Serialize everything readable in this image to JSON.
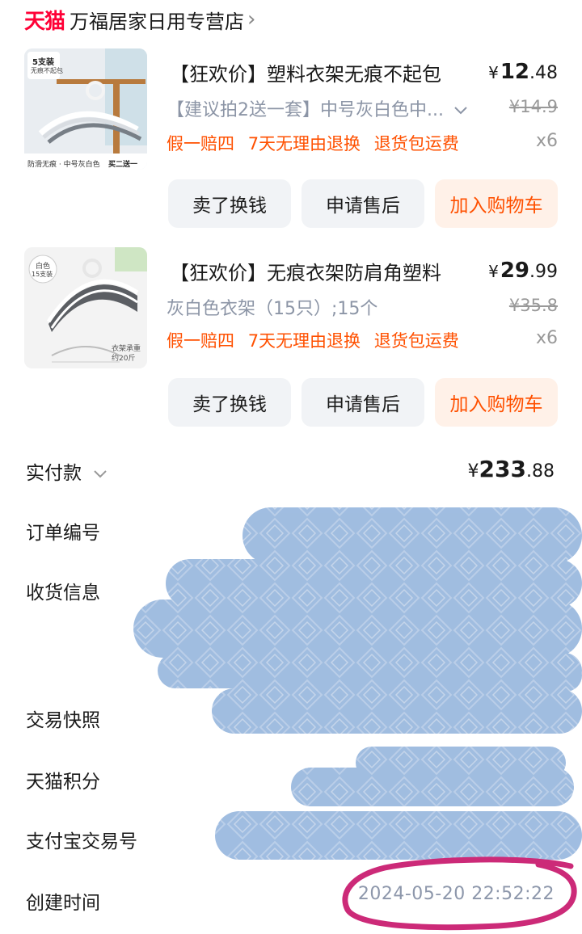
{
  "shop": {
    "brand": "天猫",
    "name": "万福居家日用专营店",
    "chevron": "›"
  },
  "items": [
    {
      "thumb_badge": "5支装",
      "thumb_sub": "无痕不起包",
      "thumb_caption": "防滑无痕 · 中号灰白色",
      "thumb_caption2": "买二送一",
      "title": "【狂欢价】塑料衣架无痕不起包",
      "price_yen": "¥",
      "price_int": "12",
      "price_dec": ".48",
      "sku": "【建议拍2送一套】中号灰白色中...",
      "orig_price": "¥14.9",
      "services": [
        "假一赔四",
        "7天无理由退换",
        "退货包运费"
      ],
      "qty": "x6",
      "buttons": {
        "sell": "卖了换钱",
        "after_sale": "申请售后",
        "cart": "加入购物车"
      }
    },
    {
      "thumb_badge": "白色",
      "thumb_sub": "15支装",
      "thumb_caption": "衣架承重",
      "thumb_caption2": "约20斤",
      "title": "【狂欢价】无痕衣架防肩角塑料",
      "price_yen": "¥",
      "price_int": "29",
      "price_dec": ".99",
      "sku": "灰白色衣架（15只）;15个",
      "orig_price": "¥35.8",
      "services": [
        "假一赔四",
        "7天无理由退换",
        "退货包运费"
      ],
      "qty": "x6",
      "buttons": {
        "sell": "卖了换钱",
        "after_sale": "申请售后",
        "cart": "加入购物车"
      }
    }
  ],
  "order": {
    "paid_label": "实付款",
    "paid_yen": "¥",
    "paid_int": "233",
    "paid_dec": ".88",
    "order_no_label": "订单编号",
    "address_label": "收货信息",
    "snapshot_label": "交易快照",
    "points_label": "天猫积分",
    "alipay_label": "支付宝交易号",
    "created_label": "创建时间",
    "created_value": "2024-05-20 22:52:22"
  },
  "colors": {
    "tmall_red": "#ff0036",
    "orange": "#ff5000",
    "redaction_blue": "#9dbbe0",
    "annotation_magenta": "#cc2a78"
  }
}
